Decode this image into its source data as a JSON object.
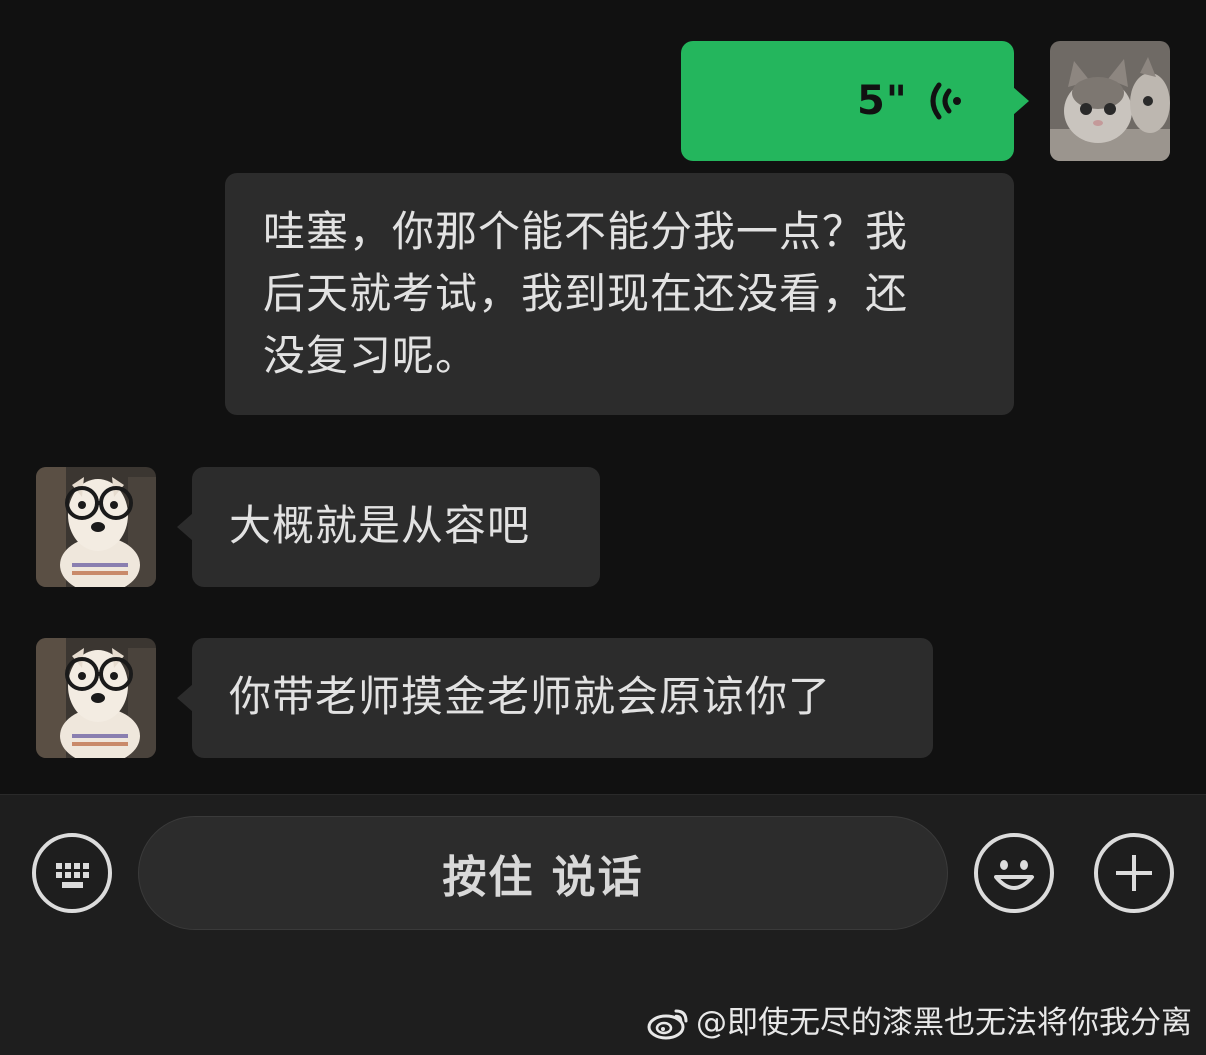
{
  "messages": {
    "voice": {
      "duration": "5\""
    },
    "long_text": {
      "lines": [
        "哇塞，你那个能不能分我一点？我",
        "后天就考试，我到现在还没看，还",
        "没复习呢。"
      ]
    },
    "reply_1": "大概就是从容吧",
    "reply_2": "你带老师摸金老师就会原谅你了"
  },
  "toolbar": {
    "hold_to_talk_label": "按住 说话"
  },
  "watermark": {
    "text": "@即使无尽的漆黑也无法将你我分离"
  },
  "colors": {
    "background": "#111111",
    "sent_bubble": "#24b65d",
    "received_bubble": "#2c2c2c",
    "text": "#e2e2e2"
  },
  "icons": [
    "keyboard-icon",
    "emoji-icon",
    "plus-icon",
    "voice-wave-icon",
    "weibo-icon"
  ]
}
